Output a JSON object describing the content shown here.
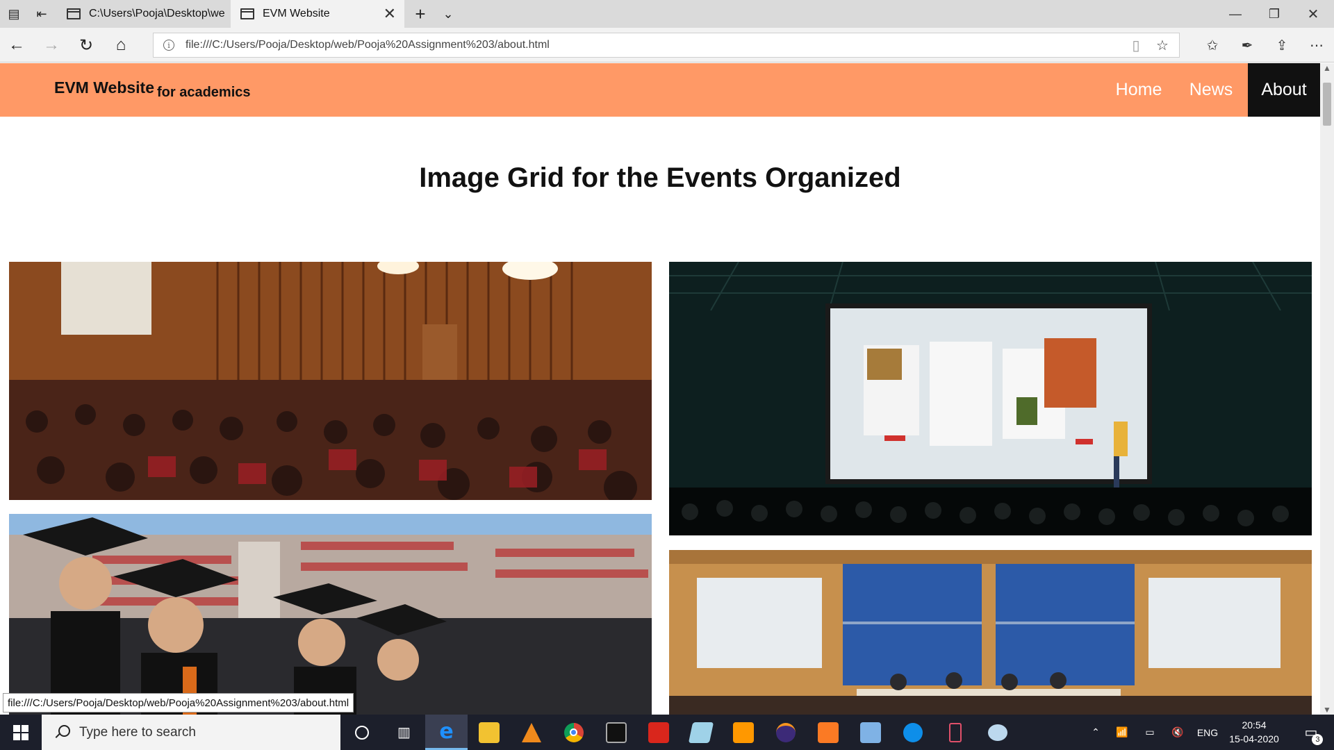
{
  "browser": {
    "tabs": [
      {
        "label": "C:\\Users\\Pooja\\Desktop\\we"
      },
      {
        "label": "EVM Website"
      }
    ],
    "address": "file:///C:/Users/Pooja/Desktop/web/Pooja%20Assignment%203/about.html",
    "status_url": "file:///C:/Users/Pooja/Desktop/web/Pooja%20Assignment%203/about.html"
  },
  "site": {
    "brand": "EVM Website",
    "brand_sub": "for academics",
    "menu": [
      {
        "label": "Home",
        "active": false
      },
      {
        "label": "News",
        "active": false
      },
      {
        "label": "About",
        "active": true
      }
    ],
    "title": "Image Grid for the Events Organized",
    "accent": "#ff9966",
    "images": [
      {
        "name": "lecture-hall-audience-photo",
        "icon": "photo"
      },
      {
        "name": "conference-presentation-stage-photo",
        "icon": "photo"
      },
      {
        "name": "graduation-ceremony-photo",
        "icon": "photo"
      },
      {
        "name": "panel-discussion-photo",
        "icon": "photo"
      }
    ]
  },
  "taskbar": {
    "search_placeholder": "Type here to search",
    "lang": "ENG",
    "time": "20:54",
    "date": "15-04-2020",
    "notifications": "3"
  }
}
